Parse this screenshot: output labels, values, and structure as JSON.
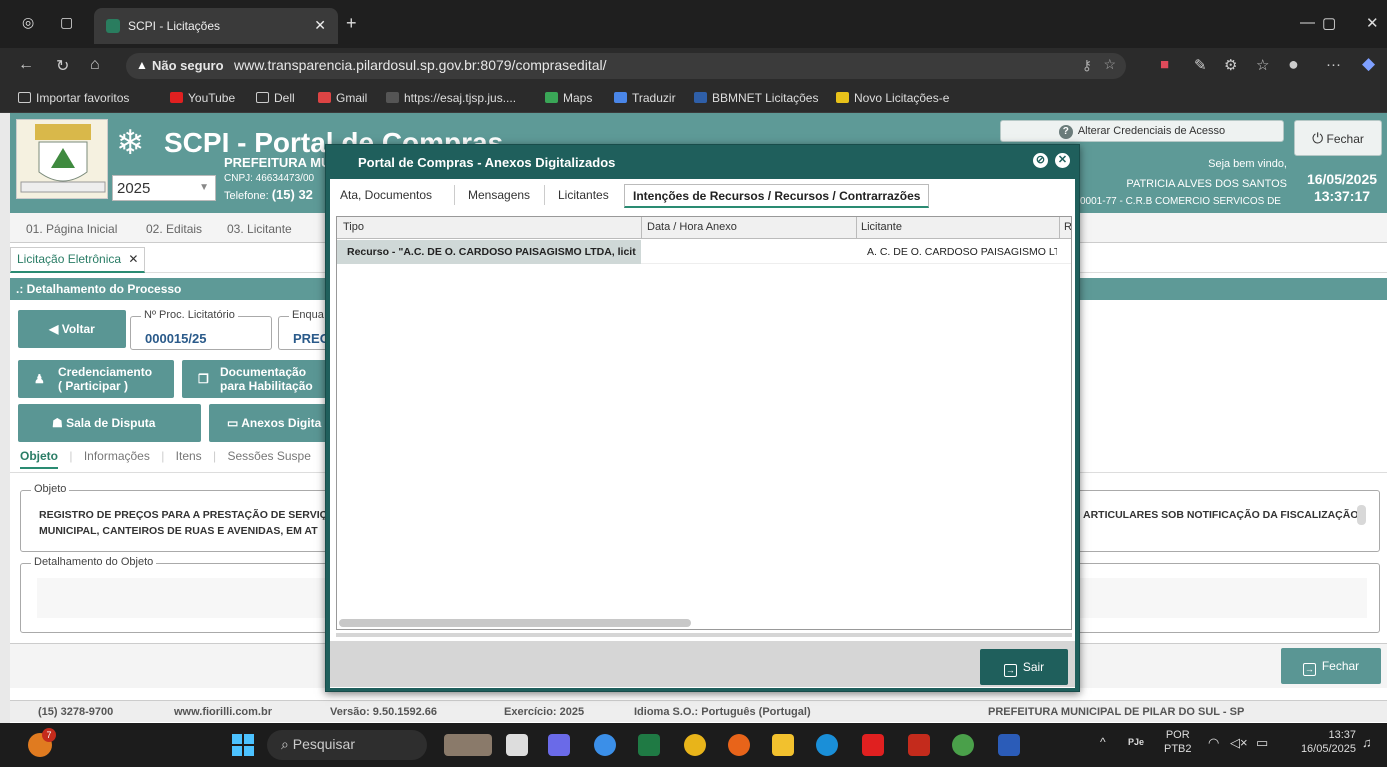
{
  "browser": {
    "tab_title": "SCPI - Licitações",
    "not_secure": "Não seguro",
    "url": "www.transparencia.pilardosul.sp.gov.br:8079/comprasedital/",
    "favorites": [
      "Importar favoritos",
      "YouTube",
      "Dell",
      "Gmail",
      "https://esaj.tjsp.jus....",
      "Maps",
      "Traduzir",
      "BBMNET Licitações",
      "Novo Licitações-e"
    ]
  },
  "header": {
    "title": "SCPI - Portal de Compras",
    "prefeitura": "PREFEITURA MU",
    "cnpj": "CNPJ: 46634473/00",
    "tel_label": "Telefone:",
    "tel_value": "(15) 32",
    "year": "2025",
    "alterar_credenciais": "Alterar Credenciais de Acesso",
    "fechar": "Fechar",
    "welcome": "Seja bem vindo,",
    "user": "PATRICIA ALVES DOS SANTOS",
    "user_cnpj": "0001-77 - C.R.B COMERCIO SERVICOS DE",
    "date": "16/05/2025",
    "time": "13:37:17"
  },
  "menu": [
    "01. Página Inicial",
    "02. Editais",
    "03. Licitante"
  ],
  "open_tab": "Licitação Eletrônica",
  "section_title": ".: Detalhamento do Processo",
  "process": {
    "voltar": "Voltar",
    "proc_label": "Nº Proc. Licitatório",
    "proc_value": "000015/25",
    "enq_label": "Enqua",
    "enq_value": "PREG",
    "credenciamento_1": "Credenciamento",
    "credenciamento_2": "( Participar )",
    "documentacao_1": "Documentação",
    "documentacao_2": "para Habilitação",
    "sala": "Sala de Disputa",
    "anexos": "Anexos Digita"
  },
  "subtabs": [
    "Objeto",
    "Informações",
    "Itens",
    "Sessões Suspe"
  ],
  "objeto": {
    "legend": "Objeto",
    "line1": "REGISTRO DE PREÇOS PARA A PRESTAÇÃO DE SERVIÇO",
    "line2": "MUNICIPAL, CANTEIROS DE RUAS E AVENIDAS, EM AT",
    "line1_right": "ARTICULARES SOB NOTIFICAÇÃO DA FISCALIZAÇÃO",
    "detalhamento_legend": "Detalhamento do Objeto"
  },
  "bottom_fechar": "Fechar",
  "statusbar": {
    "phone": "(15) 3278-9700",
    "site": "www.fiorilli.com.br",
    "versao": "Versão: 9.50.1592.66",
    "exercicio": "Exercício: 2025",
    "idioma": "Idioma S.O.: Português (Portugal)",
    "prefeitura": "PREFEITURA MUNICIPAL DE PILAR DO SUL - SP"
  },
  "modal": {
    "title": "Portal de Compras - Anexos Digitalizados",
    "tabs": [
      "Ata, Documentos",
      "Mensagens",
      "Licitantes",
      "Intenções de Recursos / Recursos / Contrarrazões"
    ],
    "columns": [
      "Tipo",
      "Data / Hora Anexo",
      "Licitante",
      "R"
    ],
    "row": {
      "tipo": "Recurso - \"A.C. DE O. CARDOSO PAISAGISMO LTDA, licit",
      "data": "",
      "licitante": "A. C. DE O. CARDOSO PAISAGISMO LTD"
    },
    "sair": "Sair"
  },
  "taskbar": {
    "search": "Pesquisar",
    "lang1": "POR",
    "lang2": "PTB2",
    "time": "13:37",
    "date": "16/05/2025",
    "badge": "7"
  }
}
